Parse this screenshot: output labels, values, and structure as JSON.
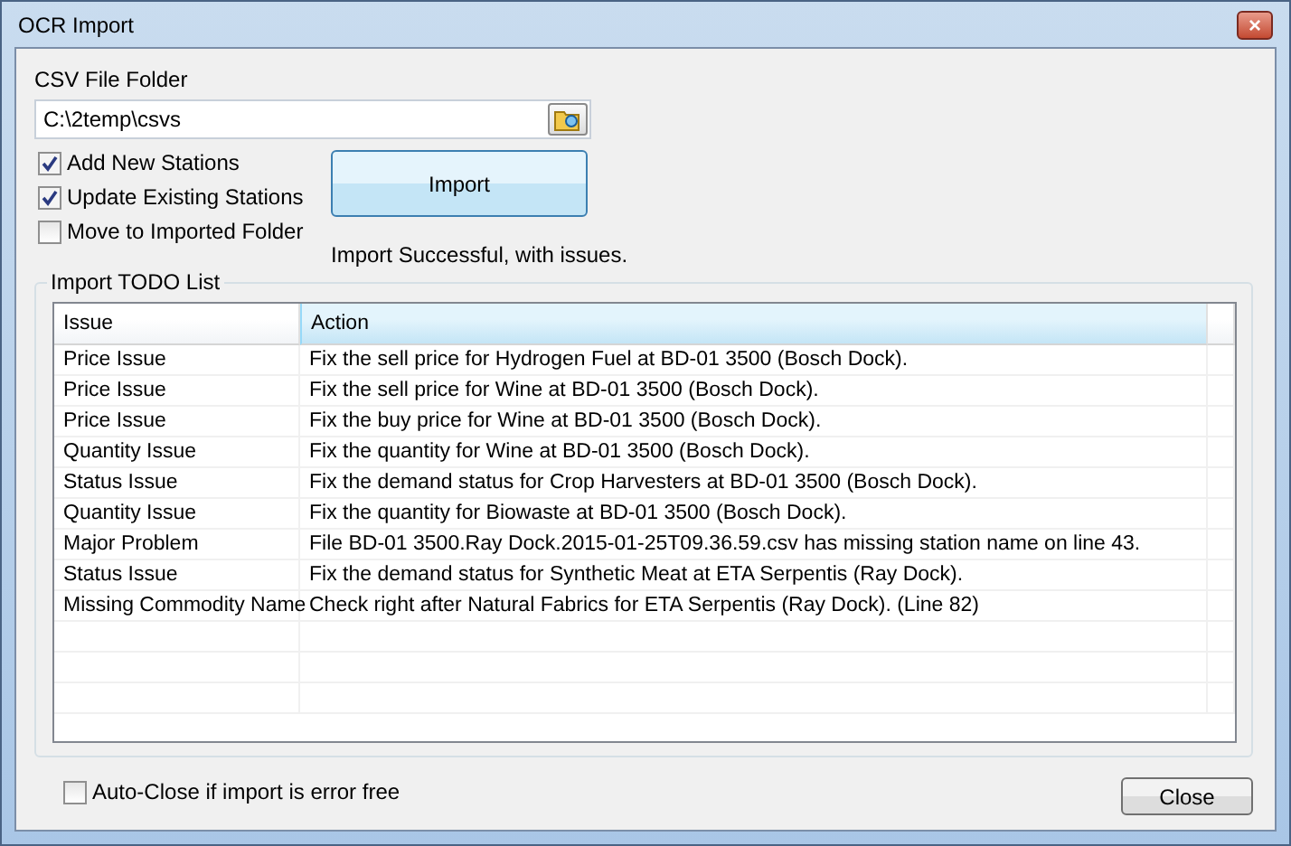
{
  "window": {
    "title": "OCR Import",
    "close": "×"
  },
  "folder": {
    "label": "CSV File Folder",
    "value": "C:\\2temp\\csvs"
  },
  "options": [
    {
      "label": "Add New Stations",
      "checked": true
    },
    {
      "label": "Update Existing Stations",
      "checked": true
    },
    {
      "label": "Move to Imported Folder",
      "checked": false
    }
  ],
  "import_button": "Import",
  "status": "Import Successful, with issues.",
  "todo": {
    "title": "Import TODO List",
    "columns": [
      "Issue",
      "Action"
    ],
    "rows": [
      [
        "Price Issue",
        "Fix the sell price for Hydrogen Fuel at BD-01 3500 (Bosch Dock)."
      ],
      [
        "Price Issue",
        "Fix the sell price for Wine at BD-01 3500 (Bosch Dock)."
      ],
      [
        "Price Issue",
        "Fix the buy price for Wine at BD-01 3500 (Bosch Dock)."
      ],
      [
        "Quantity Issue",
        "Fix the quantity for Wine at BD-01 3500 (Bosch Dock)."
      ],
      [
        "Status Issue",
        "Fix the demand status for Crop Harvesters at BD-01 3500 (Bosch Dock)."
      ],
      [
        "Quantity Issue",
        "Fix the quantity for Biowaste at BD-01 3500 (Bosch Dock)."
      ],
      [
        "Major Problem",
        "File BD-01 3500.Ray Dock.2015-01-25T09.36.59.csv has missing station name on line 43."
      ],
      [
        "Status Issue",
        "Fix the demand status for Synthetic Meat at ETA Serpentis (Ray Dock)."
      ],
      [
        "Missing Commodity Name",
        "Check right after Natural Fabrics for ETA Serpentis (Ray Dock). (Line 82)"
      ]
    ]
  },
  "auto_close": {
    "label": "Auto-Close if import is error free",
    "checked": false
  },
  "close_button": "Close"
}
